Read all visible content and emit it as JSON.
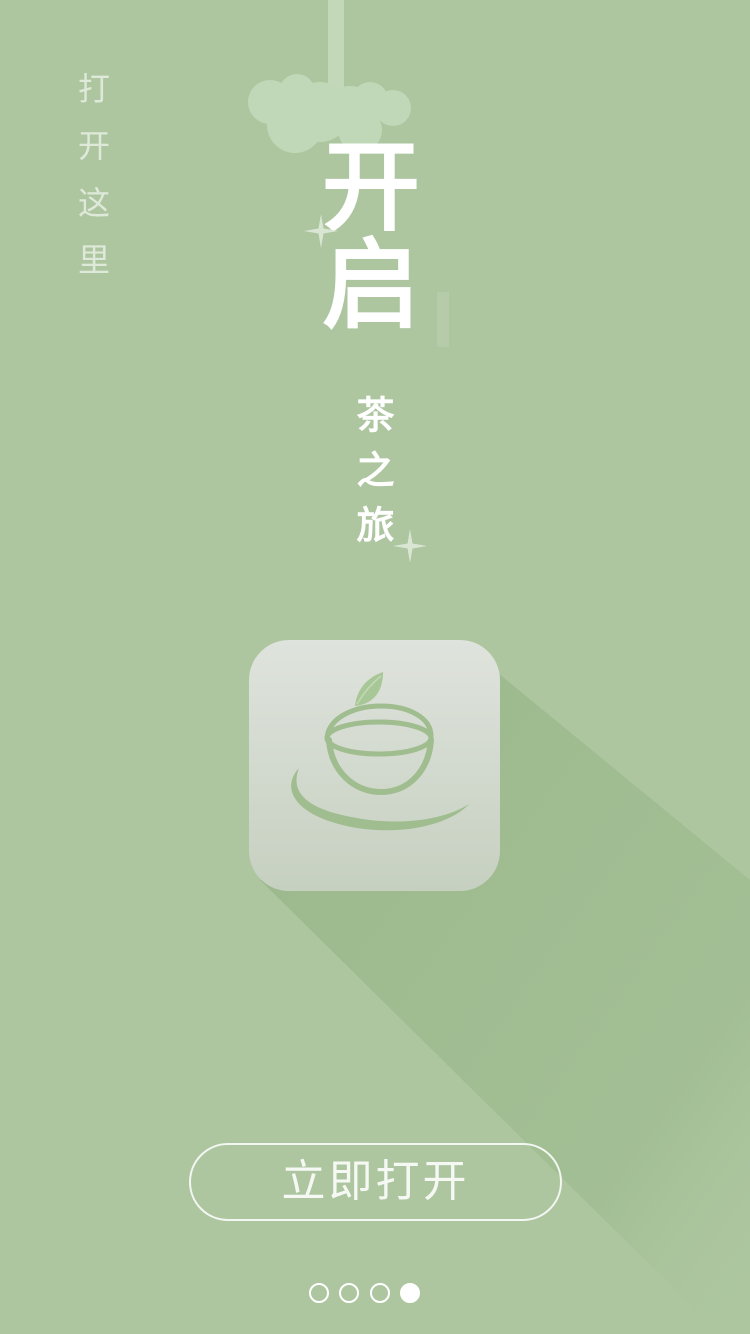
{
  "side_caption": "打开这里",
  "title": "开启",
  "subtitle": "茶之旅",
  "app_icon": {
    "icon": "tea-cup-icon",
    "leaf_color": "#a8c796",
    "cup_color": "#9fbd8e"
  },
  "open_button": {
    "label": "立即打开"
  },
  "pager": {
    "total": 4,
    "active_index": 3
  },
  "colors": {
    "background": "#adc6a0",
    "shadow": "#9dba8e",
    "text": "#ffffff"
  }
}
